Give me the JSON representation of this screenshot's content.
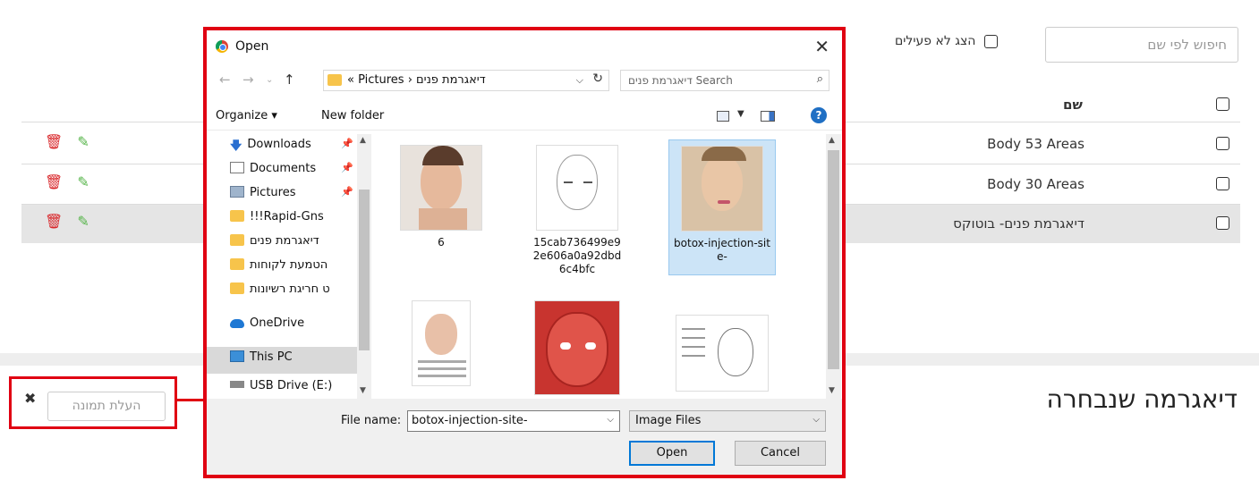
{
  "page": {
    "search_placeholder": "חיפוש לפי שם",
    "show_inactive_label": "הצג לא פעילים",
    "column_name": "שם",
    "rows": [
      {
        "name": "Body 53 Areas"
      },
      {
        "name": "Body 30 Areas"
      },
      {
        "name": "דיאגרמת פנים- בוטוקס"
      }
    ],
    "section_title": "דיאגרמה שנבחרה",
    "upload_button": "העלת תמונה",
    "upload_close": "✖"
  },
  "dialog": {
    "title": "Open",
    "close": "✕",
    "breadcrumb": "«  Pictures  ›  דיאגרמת פנים",
    "search_placeholder": "Search דיאגרמת פנים",
    "toolbar": {
      "organize": "Organize ▾",
      "new_folder": "New folder",
      "help": "?"
    },
    "nav_items": [
      {
        "label": "Downloads",
        "icon": "download-icon",
        "pinned": true
      },
      {
        "label": "Documents",
        "icon": "document-icon",
        "pinned": true
      },
      {
        "label": "Pictures",
        "icon": "pictures-icon",
        "pinned": true
      },
      {
        "label": "!!!Rapid-Gns",
        "icon": "folder-icon"
      },
      {
        "label": "דיאגרמת פנים",
        "icon": "folder-icon"
      },
      {
        "label": "הטמעת לקוחות",
        "icon": "folder-icon"
      },
      {
        "label": "ט חריגת רשיונות",
        "icon": "folder-icon"
      },
      {
        "label": "OneDrive",
        "icon": "onedrive-icon"
      },
      {
        "label": "This PC",
        "icon": "pc-icon"
      },
      {
        "label": "USB Drive (E:)",
        "icon": "usb-icon"
      }
    ],
    "files": [
      {
        "name": "6"
      },
      {
        "name": "15cab736499e92e606a0a92dbd6c4bfc"
      },
      {
        "name": "botox-injection-site-"
      },
      {
        "name": ""
      },
      {
        "name": ""
      },
      {
        "name": ""
      }
    ],
    "file_name_label": "File name:",
    "file_name_value": "botox-injection-site-",
    "file_type": "Image Files",
    "open_button": "Open",
    "cancel_button": "Cancel"
  }
}
